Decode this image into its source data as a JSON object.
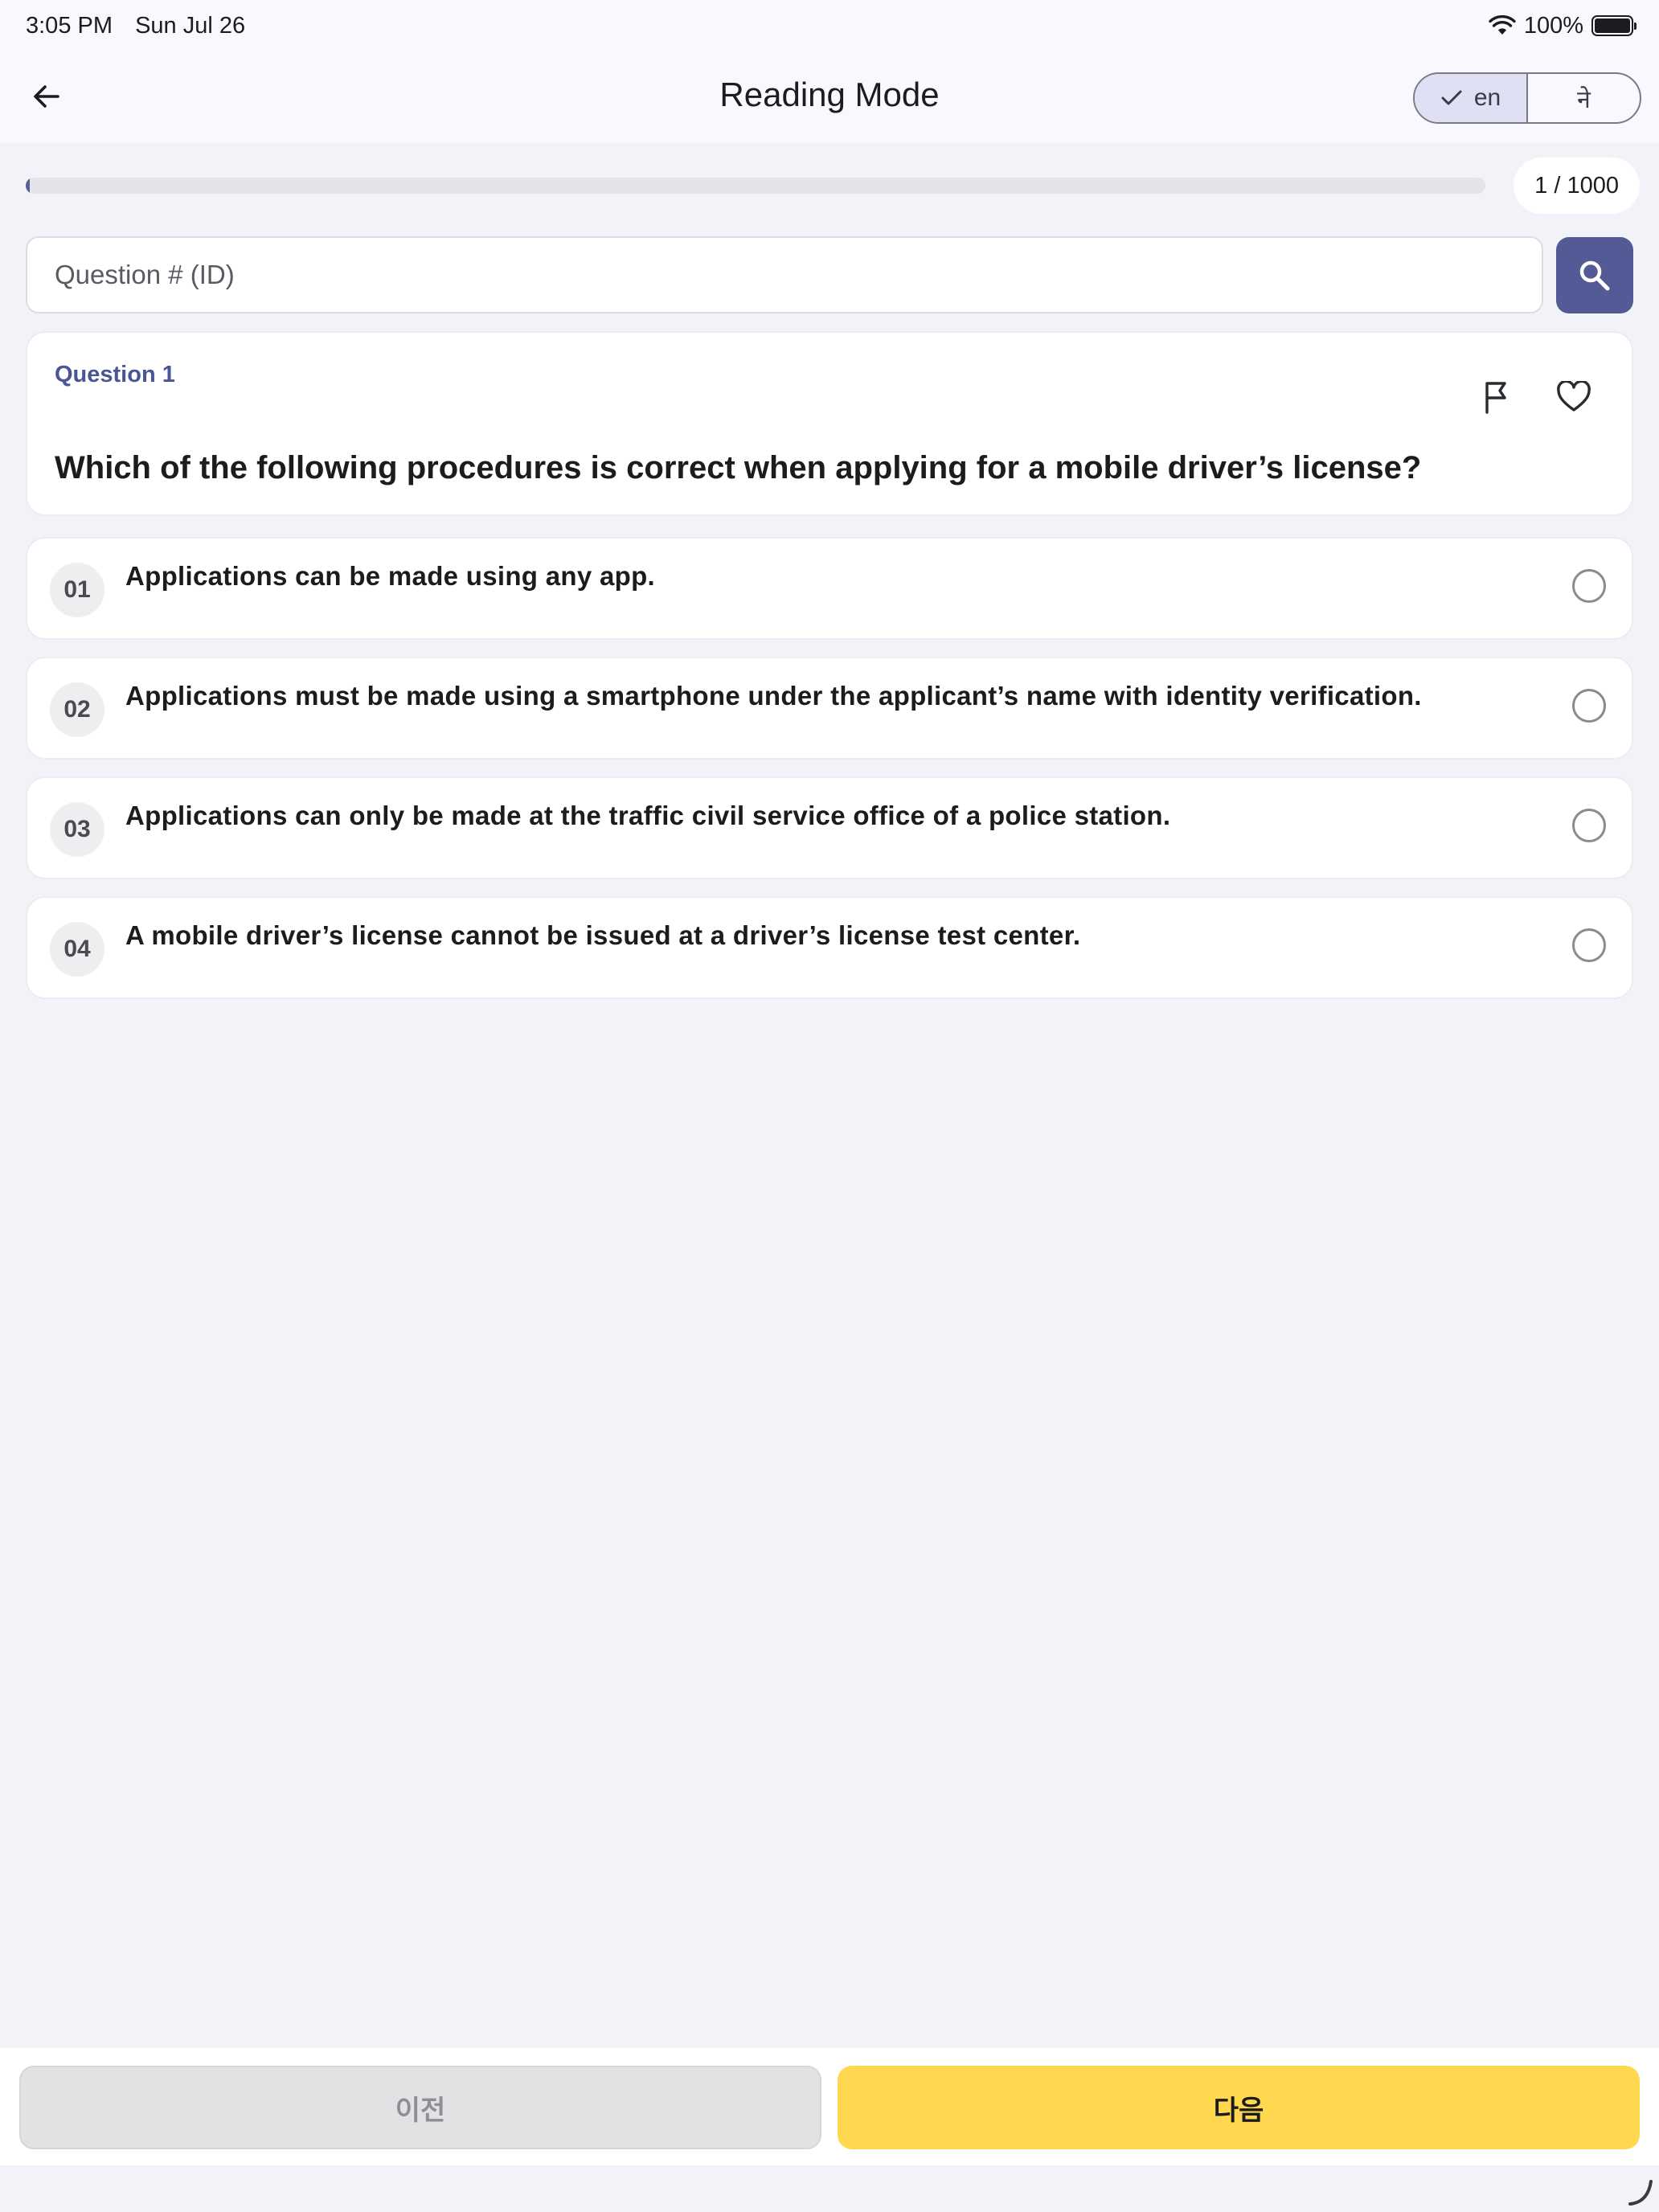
{
  "status_bar": {
    "time": "3:05 PM",
    "date": "Sun Jul 26",
    "battery": "100%"
  },
  "nav": {
    "title": "Reading Mode",
    "languages": [
      {
        "label": "en",
        "selected": true
      },
      {
        "label": "ने",
        "selected": false
      }
    ]
  },
  "progress": {
    "count_label": "1 / 1000",
    "fraction": 0.001
  },
  "search": {
    "placeholder": "Question # (ID)"
  },
  "question": {
    "label": "Question 1",
    "text": "Which of the following procedures is correct when applying for a mobile driver’s license?"
  },
  "options": [
    {
      "number": "01",
      "text": "Applications can be made using any app."
    },
    {
      "number": "02",
      "text": "Applications must be made using a smartphone under the applicant’s name with identity verification."
    },
    {
      "number": "03",
      "text": "Applications can only be made at the traffic civil service office of a police station."
    },
    {
      "number": "04",
      "text": "A mobile driver’s license cannot be issued at a driver’s license test center."
    }
  ],
  "footer": {
    "prev_label": "이전",
    "next_label": "다음"
  },
  "colors": {
    "accent": "#535a96",
    "next_button": "#ffd84f",
    "prev_button": "#e2e2e4",
    "background": "#f2f3f8"
  }
}
